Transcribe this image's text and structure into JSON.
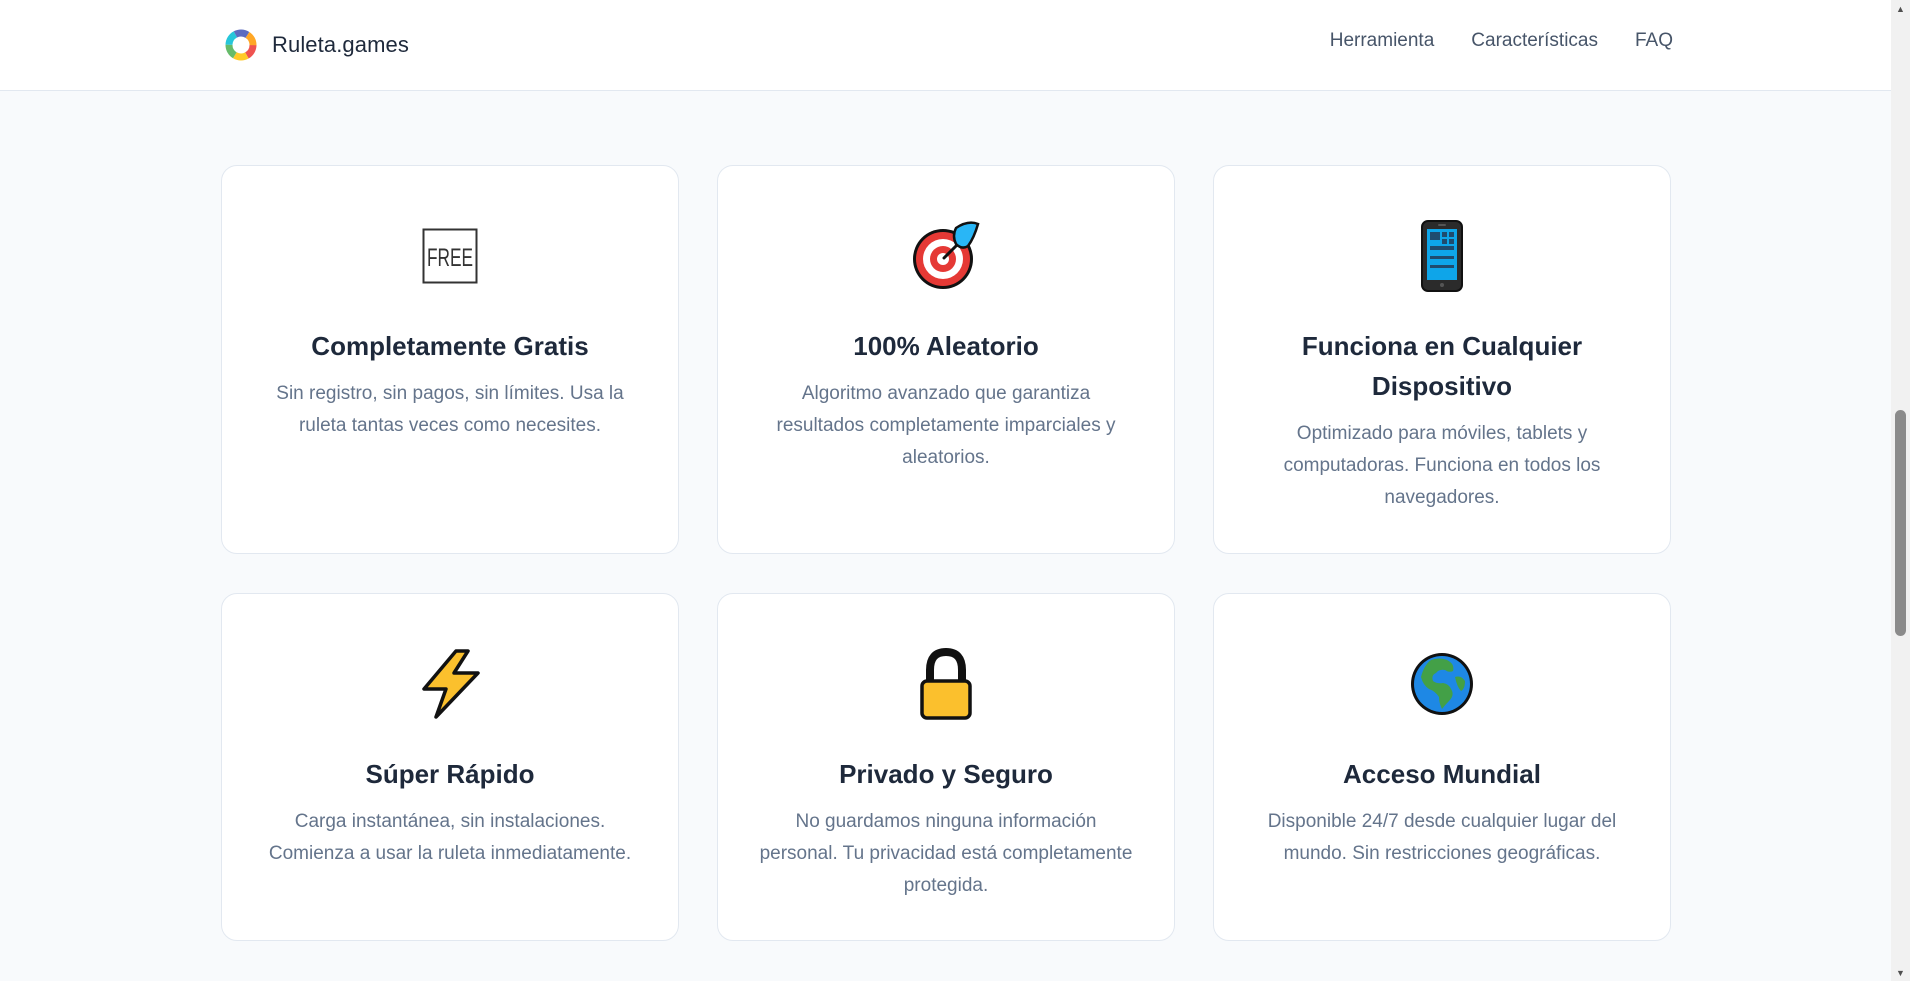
{
  "header": {
    "brand_name": "Ruleta.games",
    "nav": [
      {
        "label": "Herramienta"
      },
      {
        "label": "Características"
      },
      {
        "label": "FAQ"
      }
    ]
  },
  "features": [
    {
      "icon": "free-icon",
      "icon_text": "FREE",
      "title": "Completamente Gratis",
      "description": "Sin registro, sin pagos, sin límites. Usa la ruleta tantas veces como necesites."
    },
    {
      "icon": "direct-hit-icon",
      "title": "100% Aleatorio",
      "description": "Algoritmo avanzado que garantiza resultados completamente imparciales y aleatorios."
    },
    {
      "icon": "mobile-phone-icon",
      "title": "Funciona en Cualquier Dispositivo",
      "description": "Optimizado para móviles, tablets y computadoras. Funciona en todos los navegadores."
    },
    {
      "icon": "lightning-icon",
      "title": "Súper Rápido",
      "description": "Carga instantánea, sin instalaciones. Comienza a usar la ruleta inmediatamente."
    },
    {
      "icon": "lock-icon",
      "title": "Privado y Seguro",
      "description": "No guardamos ninguna información personal. Tu privacidad está completamente protegida."
    },
    {
      "icon": "globe-icon",
      "title": "Acceso Mundial",
      "description": "Disponible 24/7 desde cualquier lugar del mundo. Sin restricciones geográficas."
    }
  ],
  "colors": {
    "background": "#f8fafc",
    "card": "#ffffff",
    "title": "#1e293b",
    "text": "#64748b"
  }
}
